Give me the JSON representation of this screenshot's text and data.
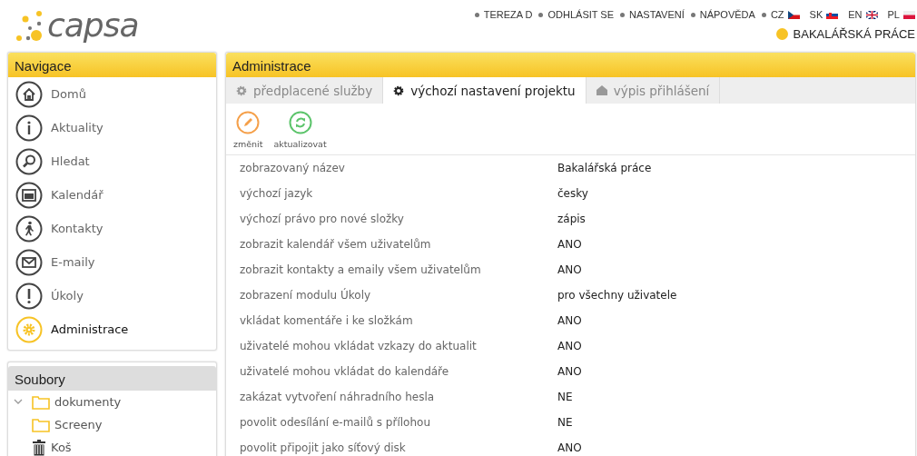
{
  "logo": {
    "text": "capsa"
  },
  "top_menu": [
    "TEREZA D",
    "ODHLÁSIT SE",
    "NASTAVENÍ",
    "NÁPOVĚDA"
  ],
  "languages": [
    {
      "code": "CZ",
      "kind": "cz"
    },
    {
      "code": "SK",
      "kind": "sk"
    },
    {
      "code": "EN",
      "kind": "en"
    },
    {
      "code": "PL",
      "kind": "pl"
    }
  ],
  "project": "BAKALÁŘSKÁ PRÁCE",
  "navigation": {
    "title": "Navigace",
    "items": [
      {
        "label": "Domů",
        "kind": "home",
        "selected": false
      },
      {
        "label": "Aktuality",
        "kind": "info",
        "selected": false
      },
      {
        "label": "Hledat",
        "kind": "search",
        "selected": false
      },
      {
        "label": "Kalendář",
        "kind": "calendar",
        "selected": false
      },
      {
        "label": "Kontakty",
        "kind": "person",
        "selected": false
      },
      {
        "label": "E-maily",
        "kind": "mail",
        "selected": false
      },
      {
        "label": "Úkoly",
        "kind": "alert",
        "selected": false
      },
      {
        "label": "Administrace",
        "kind": "gear",
        "selected": true
      }
    ]
  },
  "files": {
    "title": "Soubory",
    "items": [
      {
        "label": "dokumenty",
        "kind": "folder",
        "expanded": true,
        "children": [
          {
            "label": "Screeny",
            "kind": "folder"
          }
        ]
      },
      {
        "label": "Koš",
        "kind": "trash"
      }
    ]
  },
  "admin": {
    "title": "Administrace",
    "tabs": [
      {
        "label": "předplacené služby",
        "kind": "gear",
        "selected": false
      },
      {
        "label": "výchozí nastavení projektu",
        "kind": "gear",
        "selected": true
      },
      {
        "label": "výpis přihlášení",
        "kind": "house",
        "selected": false
      }
    ],
    "toolbar": [
      {
        "label": "změnit",
        "kind": "edit"
      },
      {
        "label": "aktualizovat",
        "kind": "refresh"
      }
    ],
    "settings": [
      {
        "name": "zobrazovaný název",
        "value": "Bakalářská práce"
      },
      {
        "name": "výchozí jazyk",
        "value": "česky"
      },
      {
        "name": "výchozí právo pro nové složky",
        "value": "zápis"
      },
      {
        "name": "zobrazit kalendář všem uživatelům",
        "value": "ANO"
      },
      {
        "name": "zobrazit kontakty a emaily všem uživatelům",
        "value": "ANO"
      },
      {
        "name": "zobrazení modulu Úkoly",
        "value": "pro všechny uživatele"
      },
      {
        "name": "vkládat komentáře i ke složkám",
        "value": "ANO"
      },
      {
        "name": "uživatelé mohou vkládat vzkazy do aktualit",
        "value": "ANO"
      },
      {
        "name": "uživatelé mohou vkládat do kalendáře",
        "value": "ANO"
      },
      {
        "name": "zakázat vytvoření náhradního hesla",
        "value": "NE"
      },
      {
        "name": "povolit odesílání e-mailů s přílohou",
        "value": "NE"
      },
      {
        "name": "povolit připojit jako síťový disk",
        "value": "ANO"
      }
    ]
  }
}
